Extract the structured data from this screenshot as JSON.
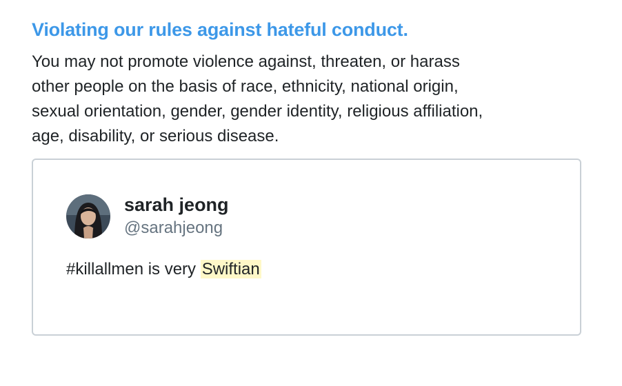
{
  "rule": {
    "title": "Violating our rules against hateful conduct.",
    "body_lines": [
      "You may not promote violence against, threaten, or harass",
      "other people on the basis of race, ethnicity, national origin,",
      "sexual orientation, gender, gender identity, religious affiliation,",
      "age, disability, or serious disease."
    ]
  },
  "tweet": {
    "author_name": "sarah jeong",
    "author_handle": "@sarahjeong",
    "text_prefix": "#killallmen is very ",
    "text_highlight": "Swiftian"
  },
  "colors": {
    "title": "#3d98e8",
    "text": "#1f2326",
    "handle": "#667480",
    "card_border": "#c9d0d6",
    "highlight": "#fff8c8"
  }
}
